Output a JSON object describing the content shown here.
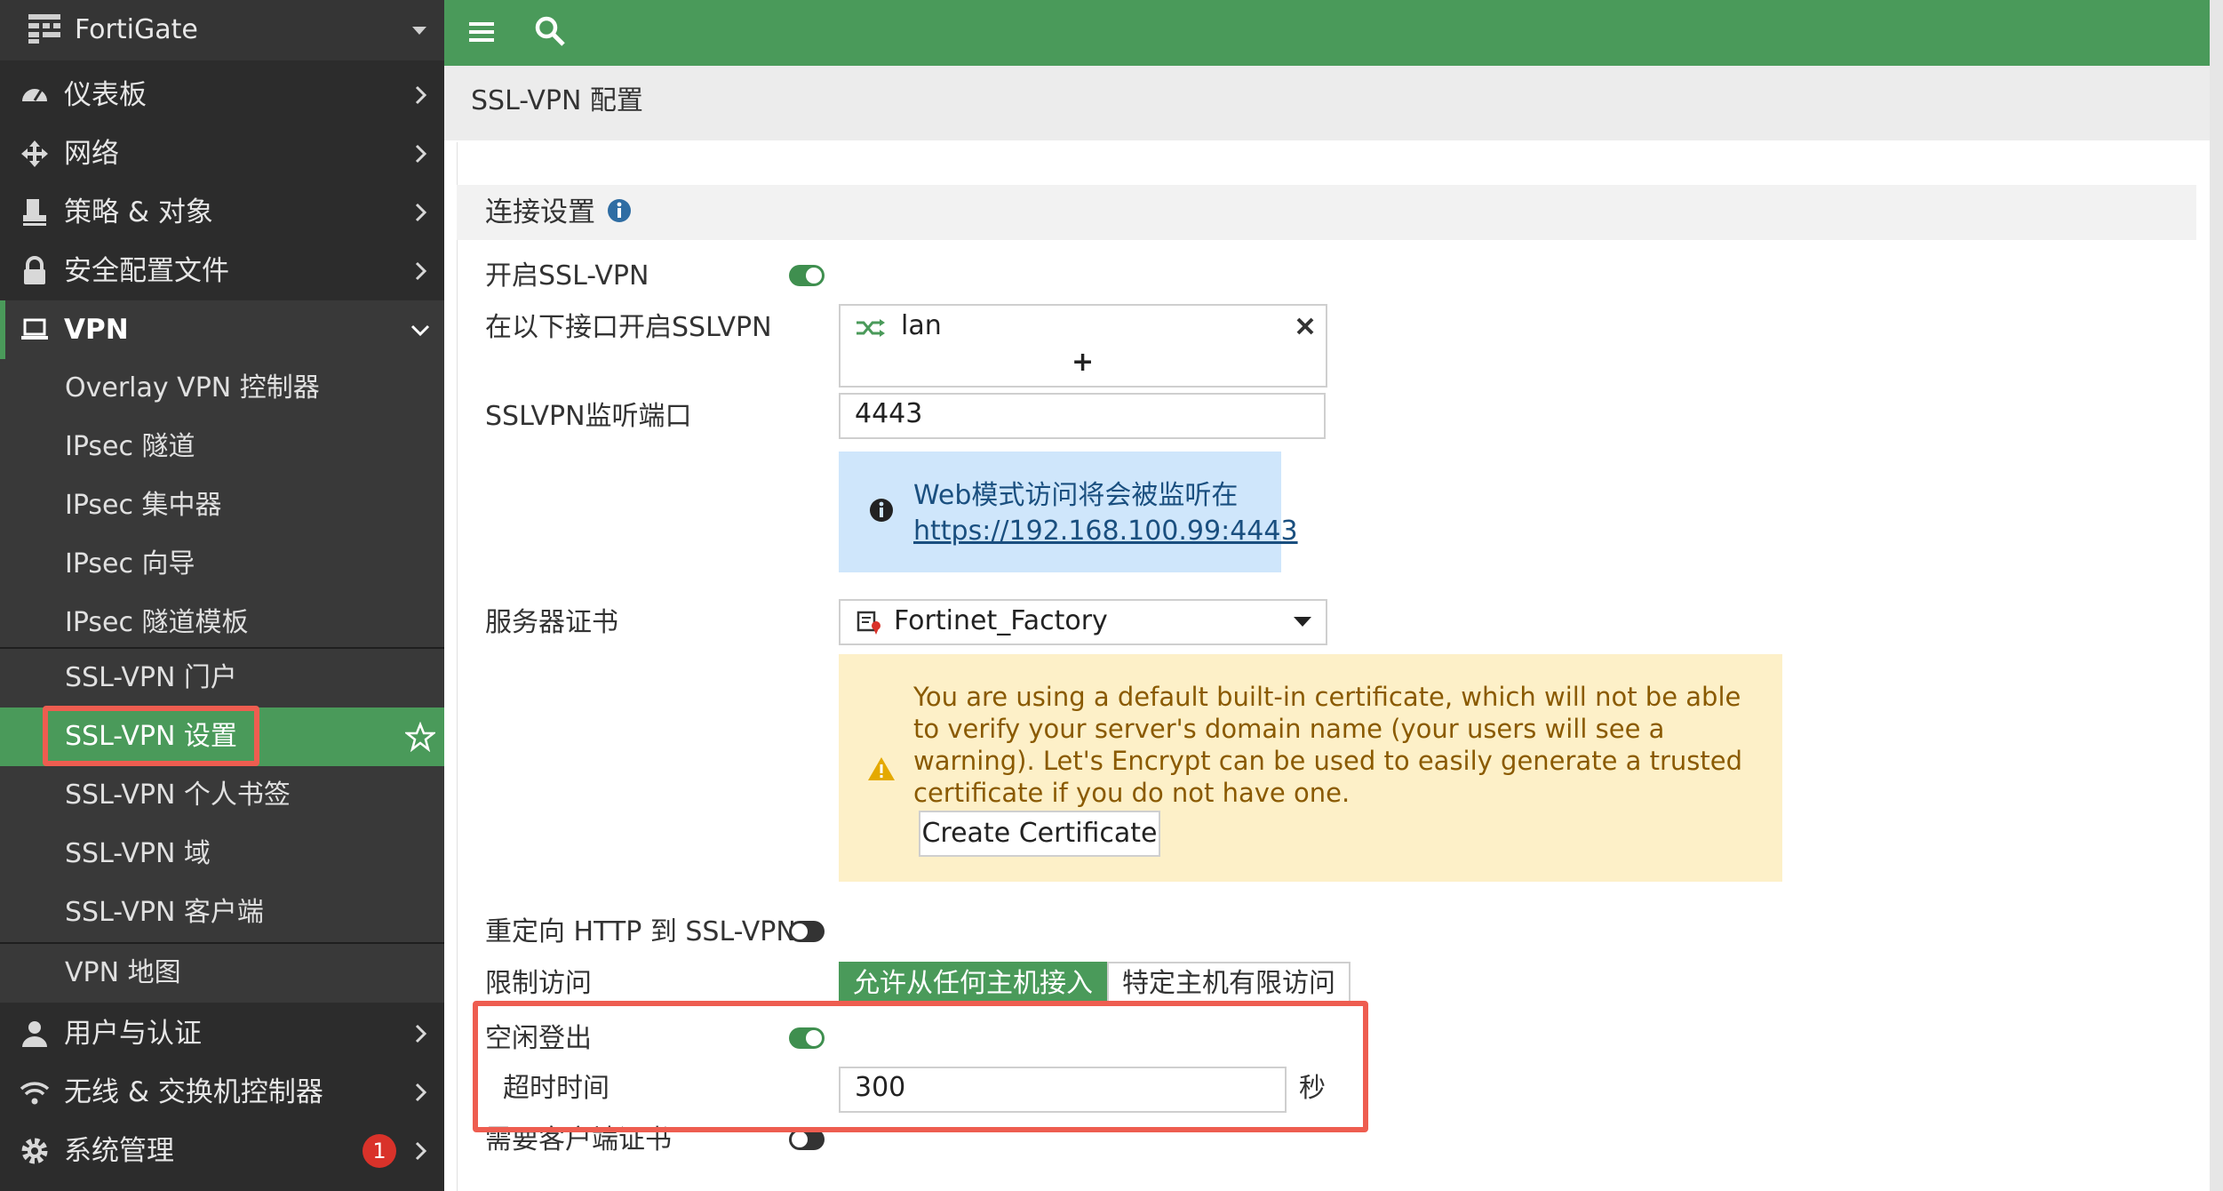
{
  "sidebar": {
    "logo_text": "FortiGate",
    "items": [
      {
        "label": "仪表板",
        "icon": "dashboard-icon"
      },
      {
        "label": "网络",
        "icon": "network-arrows-icon"
      },
      {
        "label": "策略 & 对象",
        "icon": "policy-stamp-icon"
      },
      {
        "label": "安全配置文件",
        "icon": "lock-icon"
      },
      {
        "label": "VPN",
        "icon": "laptop-icon"
      }
    ],
    "vpn_sub": [
      "Overlay VPN 控制器",
      "IPsec 隧道",
      "IPsec 集中器",
      "IPsec 向导",
      "IPsec 隧道模板",
      "SSL-VPN 门户",
      "SSL-VPN 设置",
      "SSL-VPN 个人书签",
      "SSL-VPN 域",
      "SSL-VPN 客户端",
      "VPN 地图"
    ],
    "bottom_items": [
      {
        "label": "用户与认证",
        "icon": "user-icon"
      },
      {
        "label": "无线 & 交换机控制器",
        "icon": "wifi-icon"
      },
      {
        "label": "系统管理",
        "icon": "gear-icon",
        "badge": "1"
      }
    ]
  },
  "page": {
    "title": "SSL-VPN 配置",
    "section": "连接设置"
  },
  "form": {
    "enable_label": "开启SSL-VPN",
    "iface_label": "在以下接口开启SSLVPN",
    "iface_value": "lan",
    "add_symbol": "+",
    "port_label": "SSLVPN监听端口",
    "port_value": "4443",
    "web_note_line1": "Web模式访问将会被监听在",
    "web_note_link": "https://192.168.100.99:4443",
    "cert_label": "服务器证书",
    "cert_value": "Fortinet_Factory",
    "cert_warning": "You are using a default built-in certificate, which will not be able to verify your server's domain name (your users will see a warning). Let's Encrypt can be used to easily generate a trusted certificate if you do not have one.",
    "create_cert_button": "Create Certificate",
    "redirect_label": "重定向 HTTP 到 SSL-VPN",
    "restrict_label": "限制访问",
    "restrict_opt_any": "允许从任何主机接入",
    "restrict_opt_limited": "特定主机有限访问",
    "idle_label": "空闲登出",
    "timeout_label": "超时时间",
    "timeout_value": "300",
    "timeout_unit": "秒",
    "client_cert_label": "需要客户端证书"
  },
  "colors": {
    "accent": "#4a9a5a",
    "highlight": "#ee5d50",
    "sidebar_bg": "#2c2c2c"
  }
}
